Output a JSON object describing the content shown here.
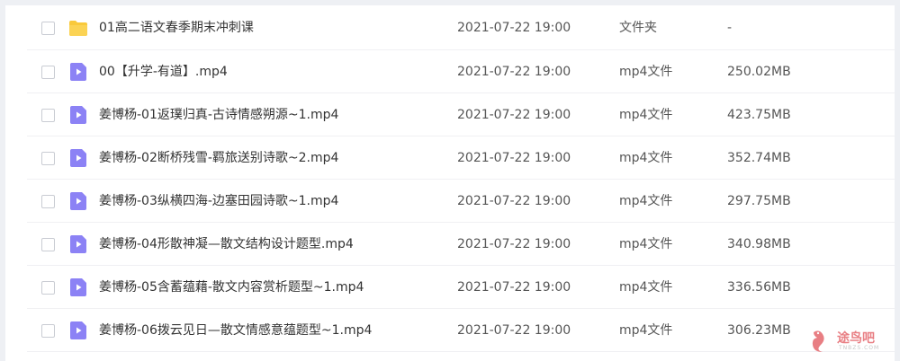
{
  "files": [
    {
      "name": "01高二语文春季期末冲刺课",
      "date": "2021-07-22 19:00",
      "type": "文件夹",
      "size": "-",
      "icon": "folder-icon"
    },
    {
      "name": "00【升学-有道】.mp4",
      "date": "2021-07-22 19:00",
      "type": "mp4文件",
      "size": "250.02MB",
      "icon": "video-file-icon"
    },
    {
      "name": "姜博杨-01返璞归真-古诗情感朔源~1.mp4",
      "date": "2021-07-22 19:00",
      "type": "mp4文件",
      "size": "423.75MB",
      "icon": "video-file-icon"
    },
    {
      "name": "姜博杨-02断桥残雪-羁旅送别诗歌~2.mp4",
      "date": "2021-07-22 19:00",
      "type": "mp4文件",
      "size": "352.74MB",
      "icon": "video-file-icon"
    },
    {
      "name": "姜博杨-03纵横四海-边塞田园诗歌~1.mp4",
      "date": "2021-07-22 19:00",
      "type": "mp4文件",
      "size": "297.75MB",
      "icon": "video-file-icon"
    },
    {
      "name": "姜博杨-04形散神凝—散文结构设计题型.mp4",
      "date": "2021-07-22 19:00",
      "type": "mp4文件",
      "size": "340.98MB",
      "icon": "video-file-icon"
    },
    {
      "name": "姜博杨-05含蓄蕴藉-散文内容赏析题型~1.mp4",
      "date": "2021-07-22 19:00",
      "type": "mp4文件",
      "size": "336.56MB",
      "icon": "video-file-icon"
    },
    {
      "name": "姜博杨-06拨云见日—散文情感意蕴题型~1.mp4",
      "date": "2021-07-22 19:00",
      "type": "mp4文件",
      "size": "306.23MB",
      "icon": "video-file-icon"
    }
  ],
  "watermark": {
    "text": "途鸟吧",
    "sub": "TNBZS.COM"
  },
  "colors": {
    "folder": "#f9c93b",
    "video": "#8c82f5",
    "border": "#f0f0f3"
  }
}
